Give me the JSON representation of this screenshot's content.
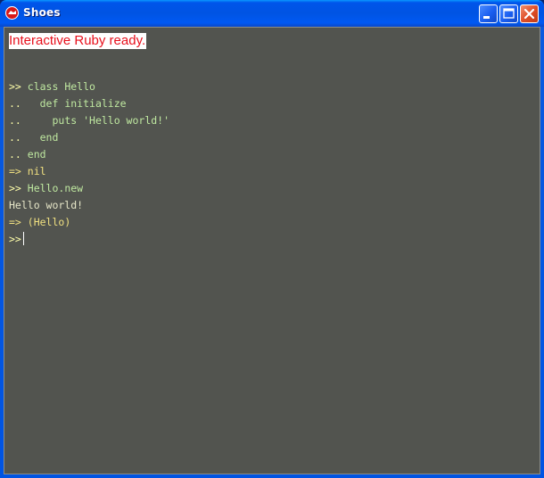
{
  "window": {
    "title": "Shoes",
    "icon": "shoes-app-icon",
    "controls": [
      "minimize",
      "maximize",
      "close"
    ]
  },
  "banner": {
    "text": "Interactive Ruby ready."
  },
  "console": {
    "lines": [
      {
        "prompt": ">>",
        "text": " class Hello",
        "kind": "code"
      },
      {
        "prompt": "..",
        "text": "   def initialize",
        "kind": "code"
      },
      {
        "prompt": "..",
        "text": "     puts 'Hello world!'",
        "kind": "code"
      },
      {
        "prompt": "..",
        "text": "   end",
        "kind": "code"
      },
      {
        "prompt": "..",
        "text": " end",
        "kind": "code"
      },
      {
        "prompt": "=>",
        "text": " nil",
        "kind": "result"
      },
      {
        "prompt": ">>",
        "text": " Hello.new",
        "kind": "code"
      },
      {
        "prompt": "",
        "text": "Hello world!",
        "kind": "output"
      },
      {
        "prompt": "=>",
        "text": " (Hello)",
        "kind": "result"
      }
    ],
    "input_prompt": ">>"
  },
  "colors": {
    "background": "#52544f",
    "banner_text": "#e8101c",
    "prompt": "#ffffaa",
    "code": "#bfe8a0",
    "result": "#f0e080",
    "output": "#e6e6c8"
  }
}
